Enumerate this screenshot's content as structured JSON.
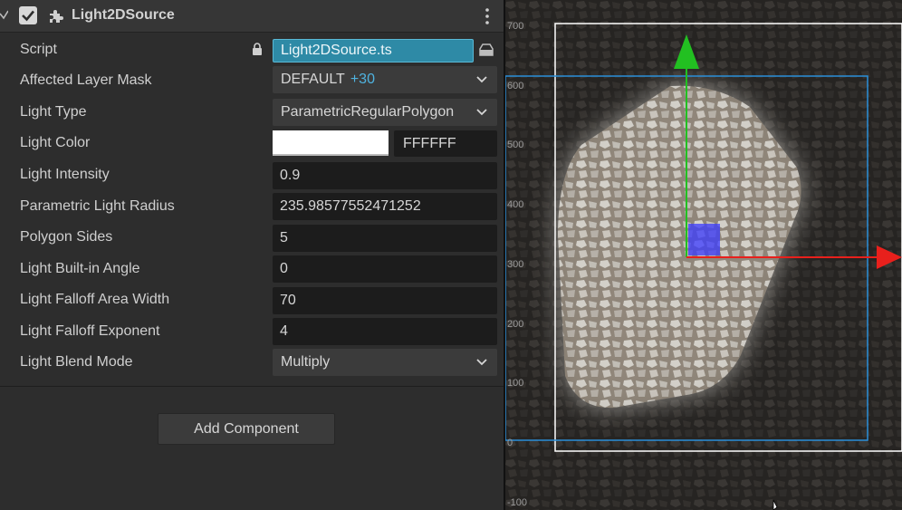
{
  "component": {
    "title": "Light2DSource",
    "enabled": true,
    "icons": {
      "collapse": "chevron-down-icon",
      "component": "puzzle-piece-icon",
      "menu": "kebab-menu-icon"
    }
  },
  "properties": {
    "script": {
      "label": "Script",
      "value": "Light2DSource.ts"
    },
    "affected_layer_mask": {
      "label": "Affected Layer Mask",
      "value": "DEFAULT",
      "extra": "+30"
    },
    "light_type": {
      "label": "Light Type",
      "value": "ParametricRegularPolygon"
    },
    "light_color": {
      "label": "Light Color",
      "swatch": "#FFFFFF",
      "hex": "FFFFFF"
    },
    "light_intensity": {
      "label": "Light Intensity",
      "value": "0.9"
    },
    "parametric_light_radius": {
      "label": "Parametric Light Radius",
      "value": "235.98577552471252"
    },
    "polygon_sides": {
      "label": "Polygon Sides",
      "value": "5"
    },
    "light_builtin_angle": {
      "label": "Light Built-in Angle",
      "value": "0"
    },
    "light_falloff_area_width": {
      "label": "Light Falloff Area Width",
      "value": "70"
    },
    "light_falloff_exponent": {
      "label": "Light Falloff Exponent",
      "value": "4"
    },
    "light_blend_mode": {
      "label": "Light Blend Mode",
      "value": "Multiply"
    }
  },
  "add_component": {
    "label": "Add Component"
  },
  "scene": {
    "y_axis_labels": [
      "700",
      "600",
      "500",
      "400",
      "300",
      "200",
      "100",
      "0",
      "-100"
    ],
    "colors": {
      "x_axis": "#e8201c",
      "y_axis": "#22c021",
      "selection_rect": "#2a8fd9",
      "canvas_frame": "#ffffff",
      "node_handle": "#3b3bff"
    }
  }
}
